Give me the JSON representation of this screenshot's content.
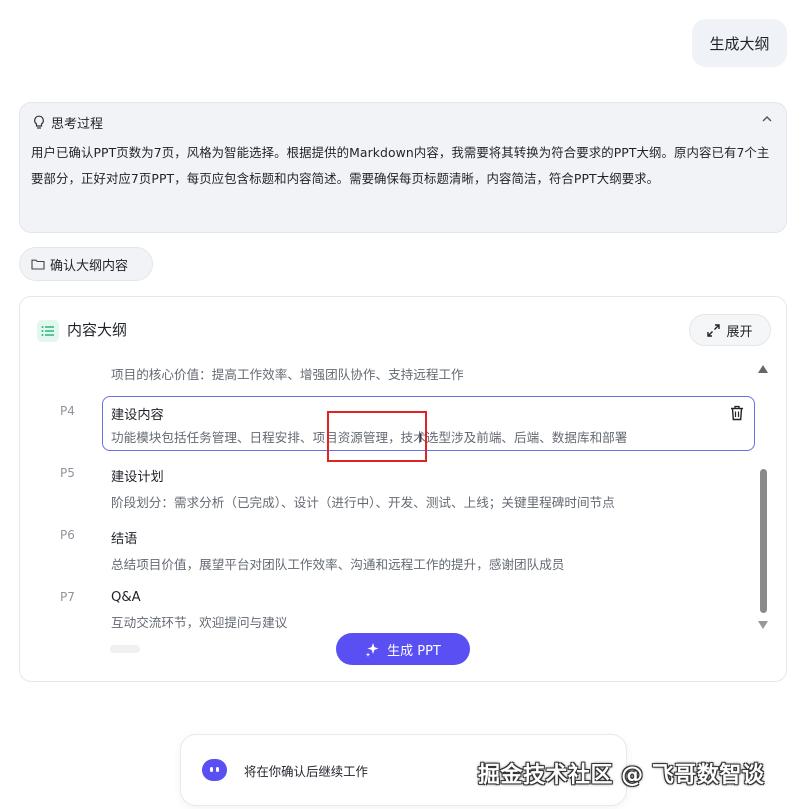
{
  "user_message": "生成大纲",
  "thinking": {
    "title": "思考过程",
    "body": "用户已确认PPT页数为7页，风格为智能选择。根据提供的Markdown内容，我需要将其转换为符合要求的PPT大纲。原内容已有7个主要部分，正好对应7页PPT，每页应包含标题和内容简述。需要确保每页标题清晰，内容简洁，符合PPT大纲要求。"
  },
  "confirm_chip": "确认大纲内容",
  "outline": {
    "title": "内容大纲",
    "expand_label": "展开",
    "top_desc": "项目的核心价值：提高工作效率、增强团队协作、支持远程工作",
    "items": [
      {
        "page": "P4",
        "title": "建设内容",
        "desc": "功能模块包括任务管理、日程安排、项目资源管理，技术选型涉及前端、后端、数据库和部署"
      },
      {
        "page": "P5",
        "title": "建设计划",
        "desc": "阶段划分：需求分析（已完成）、设计（进行中）、开发、测试、上线；关键里程碑时间节点"
      },
      {
        "page": "P6",
        "title": "结语",
        "desc": "总结项目价值，展望平台对团队工作效率、沟通和远程工作的提升，感谢团队成员"
      },
      {
        "page": "P7",
        "title": "Q&A",
        "desc": "互动交流环节，欢迎提问与建议"
      }
    ],
    "generate_label": "生成 PPT"
  },
  "status": "将在你确认后继续工作",
  "watermark": "掘金技术社区 @ 飞哥数智谈",
  "colors": {
    "accent": "#5a4ff2",
    "highlight": "#e02424",
    "active_border": "#6b6ee6"
  }
}
